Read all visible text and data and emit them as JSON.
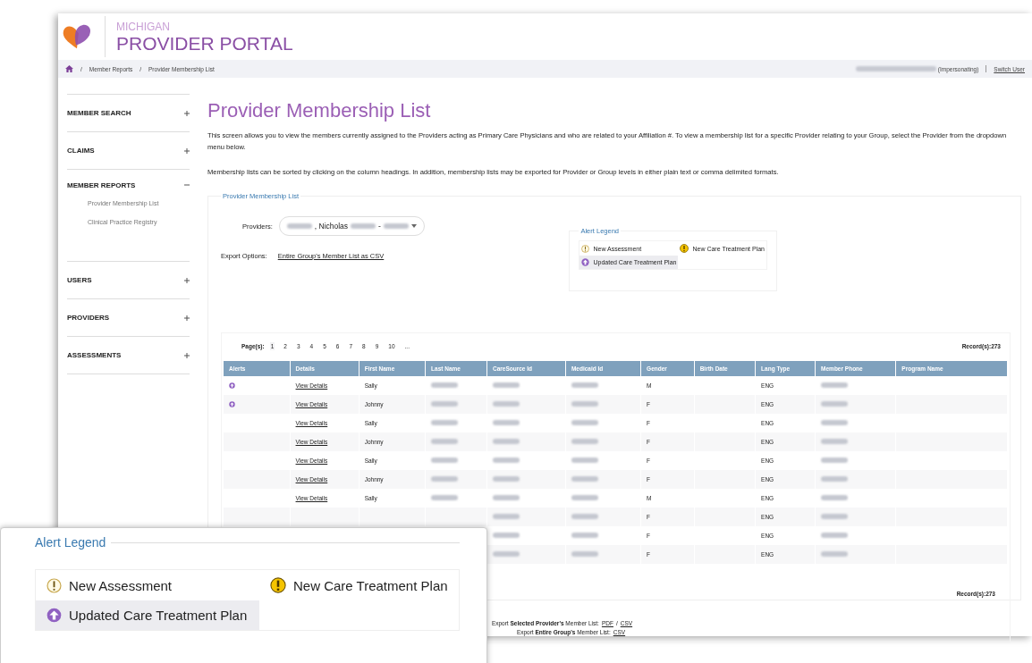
{
  "header": {
    "region": "MICHIGAN",
    "title": "PROVIDER PORTAL"
  },
  "breadcrumb": {
    "separator": "/",
    "items": [
      {
        "kind": "home"
      },
      {
        "kind": "link",
        "label": "Member Reports"
      },
      {
        "kind": "text",
        "label": "Provider Membership List"
      }
    ]
  },
  "user_bar": {
    "name_redacted": true,
    "status": "(Impersonating)",
    "switch_link": "Switch User"
  },
  "sidebar": {
    "items": [
      {
        "label": "MEMBER SEARCH",
        "expanded": false
      },
      {
        "label": "CLAIMS",
        "expanded": false
      },
      {
        "label": "MEMBER REPORTS",
        "expanded": true,
        "children": [
          {
            "label": "Provider Membership List",
            "selected": false
          },
          {
            "label": "Clinical Practice Registry",
            "selected": false
          }
        ]
      },
      {
        "label": "USERS",
        "expanded": false
      },
      {
        "label": "PROVIDERS",
        "expanded": false
      },
      {
        "label": "ASSESSMENTS",
        "expanded": false
      }
    ]
  },
  "page_title": "Provider Membership List",
  "intro": [
    "This screen allows you to view the members currently assigned to the Providers acting as Primary Care Physicians and who are related to your Affiliation #. To view a membership list for a specific Provider relating to your Group, select the Provider from the dropdown menu below.",
    "Membership lists can be sorted by clicking on the column headings. In addition, membership lists may be exported for Provider or Group levels in either plain text or comma delimited formats."
  ],
  "panel": {
    "legend": "Provider Membership List",
    "providers": {
      "label": "Providers:",
      "value": [
        {
          "redacted": true
        },
        {
          "text": ", Nicholas"
        },
        {
          "redacted": true
        },
        {
          "text": "-"
        },
        {
          "redacted": true
        }
      ]
    },
    "export": {
      "label": "Export Options:",
      "link": "Entire Group's Member List as CSV"
    },
    "alert_legend": {
      "title": "Alert Legend",
      "items": [
        {
          "kind": "new_assessment",
          "label": "New Assessment",
          "highlighted": false
        },
        {
          "kind": "new_plan",
          "label": "New Care Treatment Plan",
          "highlighted": false
        },
        {
          "kind": "updated_plan",
          "label": "Updated Care Treatment Plan",
          "highlighted": true
        }
      ]
    }
  },
  "table": {
    "pages_label": "Page(s):",
    "pages": [
      {
        "label": "1",
        "selected": true
      },
      {
        "label": "2",
        "selected": false
      },
      {
        "label": "3",
        "selected": false
      },
      {
        "label": "4",
        "selected": false
      },
      {
        "label": "5",
        "selected": false
      },
      {
        "label": "6",
        "selected": false
      },
      {
        "label": "7",
        "selected": false
      },
      {
        "label": "8",
        "selected": false
      },
      {
        "label": "9",
        "selected": false
      },
      {
        "label": "10",
        "selected": false
      },
      {
        "label": "...",
        "selected": false
      }
    ],
    "records_top": "Record(s):273",
    "columns": [
      "Alerts",
      "Details",
      "First Name",
      "Last Name",
      "CareSource Id",
      "Medicaid Id",
      "Gender",
      "Birth Date",
      "Lang Type",
      "Member Phone",
      "Program Name"
    ],
    "rows": [
      {
        "cells": [
          {
            "kind": "updated_plan"
          },
          "View Details",
          "Sally",
          {
            "redacted": true
          },
          {
            "redacted": true
          },
          {
            "redacted": true
          },
          "M",
          null,
          "ENG",
          {
            "redacted": true
          },
          null
        ]
      },
      {
        "cells": [
          {
            "kind": "updated_plan"
          },
          "View Details",
          "Johnny",
          {
            "redacted": true
          },
          {
            "redacted": true
          },
          {
            "redacted": true
          },
          "F",
          null,
          "ENG",
          {
            "redacted": true
          },
          null
        ]
      },
      {
        "cells": [
          null,
          "View Details",
          "Sally",
          {
            "redacted": true
          },
          {
            "redacted": true
          },
          {
            "redacted": true
          },
          "F",
          null,
          "ENG",
          {
            "redacted": true
          },
          null
        ]
      },
      {
        "cells": [
          null,
          "View Details",
          "Johnny",
          {
            "redacted": true
          },
          {
            "redacted": true
          },
          {
            "redacted": true
          },
          "F",
          null,
          "ENG",
          {
            "redacted": true
          },
          null
        ]
      },
      {
        "cells": [
          null,
          "View Details",
          "Sally",
          {
            "redacted": true
          },
          {
            "redacted": true
          },
          {
            "redacted": true
          },
          "F",
          null,
          "ENG",
          {
            "redacted": true
          },
          null
        ]
      },
      {
        "cells": [
          null,
          "View Details",
          "Johnny",
          {
            "redacted": true
          },
          {
            "redacted": true
          },
          {
            "redacted": true
          },
          "F",
          null,
          "ENG",
          {
            "redacted": true
          },
          null
        ]
      },
      {
        "cells": [
          null,
          "View Details",
          "Sally",
          {
            "redacted": true
          },
          {
            "redacted": true
          },
          {
            "redacted": true
          },
          "M",
          null,
          "ENG",
          {
            "redacted": true
          },
          null
        ]
      },
      {
        "cells": [
          null,
          null,
          null,
          null,
          {
            "redacted": true
          },
          {
            "redacted": true
          },
          "F",
          null,
          "ENG",
          {
            "redacted": true
          },
          null
        ]
      },
      {
        "cells": [
          null,
          null,
          null,
          null,
          {
            "redacted": true
          },
          {
            "redacted": true
          },
          "F",
          null,
          "ENG",
          {
            "redacted": true
          },
          null
        ]
      },
      {
        "cells": [
          null,
          null,
          null,
          null,
          {
            "redacted": true
          },
          {
            "redacted": true
          },
          "F",
          null,
          "ENG",
          {
            "redacted": true
          },
          null
        ]
      }
    ],
    "records_bottom": "Record(s):273",
    "exports": [
      {
        "text": "Export **Selected Provider's** Member List:",
        "links": [
          "PDF",
          "CSV"
        ],
        "separator": "/"
      },
      {
        "text": "Export **Entire Group's** Member List:",
        "links": [
          "CSV"
        ]
      }
    ]
  },
  "inset": {
    "title": "Alert Legend",
    "items": [
      {
        "kind": "new_assessment",
        "label": "New Assessment",
        "highlighted": false
      },
      {
        "kind": "new_plan",
        "label": "New Care Treatment Plan",
        "highlighted": false
      },
      {
        "kind": "updated_plan",
        "label": "Updated Care Treatment Plan",
        "highlighted": true
      }
    ]
  }
}
